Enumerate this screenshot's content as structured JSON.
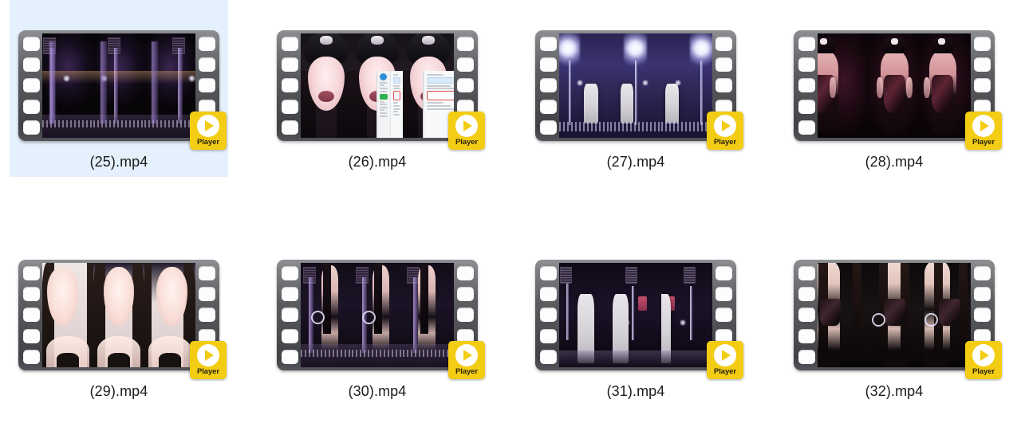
{
  "view": {
    "type": "thumbnail-grid",
    "columns": 4,
    "rows": 2,
    "background_color": "#ffffff",
    "selection_color": "#e4f0fb"
  },
  "badge": {
    "label": "Player",
    "background_color": "#f3cc14",
    "icon": "play-icon"
  },
  "files": [
    {
      "name": "(25).mp4",
      "selected": true,
      "scene": "s25",
      "thumbnail_description": "dark concert stage with purple light poles"
    },
    {
      "name": "(26).mp4",
      "selected": false,
      "scene": "s26",
      "thumbnail_description": "close-up face with black cap and phone screenshot overlay"
    },
    {
      "name": "(27).mp4",
      "selected": false,
      "scene": "s27",
      "thumbnail_description": "bright white studio lights in purple room"
    },
    {
      "name": "(28).mp4",
      "selected": false,
      "scene": "s28",
      "thumbnail_description": "dark magenta lit figure in black latex outfit"
    },
    {
      "name": "(29).mp4",
      "selected": false,
      "scene": "s29",
      "thumbnail_description": "bright close-up portrait with long dark hair"
    },
    {
      "name": "(30).mp4",
      "selected": false,
      "scene": "s30",
      "thumbnail_description": "dark purple stage with standing figure"
    },
    {
      "name": "(31).mp4",
      "selected": false,
      "scene": "s31",
      "thumbnail_description": "white chairs in dark purple studio"
    },
    {
      "name": "(32).mp4",
      "selected": false,
      "scene": "s32",
      "thumbnail_description": "dark scene figure in black outfit with long hair"
    }
  ]
}
